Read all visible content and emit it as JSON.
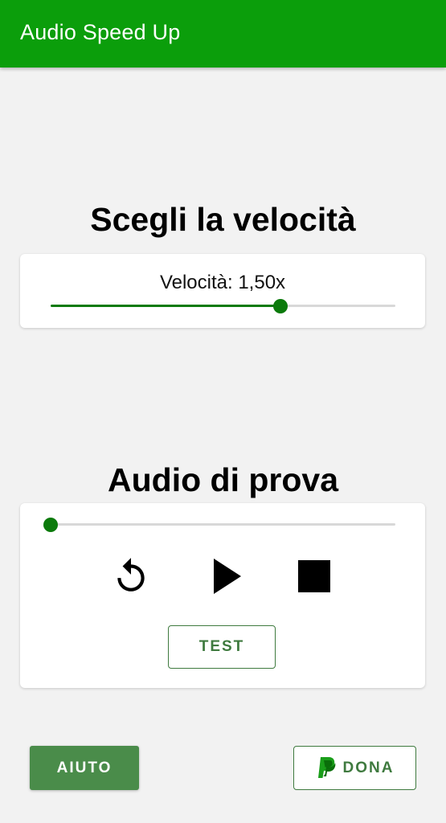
{
  "app_bar": {
    "title": "Audio Speed Up",
    "color": "#0b9e0b"
  },
  "speed_section": {
    "title": "Scegli la velocità",
    "label": "Velocità: 1,50x",
    "slider_fraction": 0.667
  },
  "audio_section": {
    "title": "Audio di prova",
    "progress_fraction": 0.0,
    "controls": {
      "replay_icon": "replay-icon",
      "play_icon": "play-icon",
      "stop_icon": "stop-icon"
    },
    "test_label": "TEST"
  },
  "footer": {
    "help_label": "AIUTO",
    "donate_label": "DONA",
    "donate_icon": "paypal-icon"
  },
  "colors": {
    "accent": "#0b7a0b",
    "button_green": "#4a8c4a",
    "outline_green": "#3f7a3f"
  }
}
